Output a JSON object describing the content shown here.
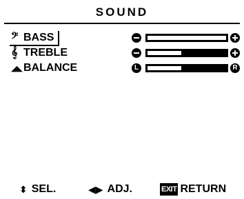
{
  "title": "SOUND",
  "menu": {
    "items": [
      {
        "label": "BASS",
        "icon": "bass-clef-icon",
        "icon_glyph": "𝄢",
        "selected": true,
        "left_button": "minus",
        "right_button": "plus",
        "level": 1.0
      },
      {
        "label": "TREBLE",
        "icon": "treble-clef-icon",
        "icon_glyph": "𝄞",
        "selected": false,
        "left_button": "minus",
        "right_button": "plus",
        "level": 0.43
      },
      {
        "label": "BALANCE",
        "icon": "balance-icon",
        "icon_glyph": "◢◣",
        "selected": false,
        "left_button": "L",
        "right_button": "R",
        "level": 0.43
      }
    ]
  },
  "footer": {
    "sel_label": "SEL.",
    "adj_label": "ADJ.",
    "exit_badge": "EXIT",
    "return_label": "RETURN"
  }
}
